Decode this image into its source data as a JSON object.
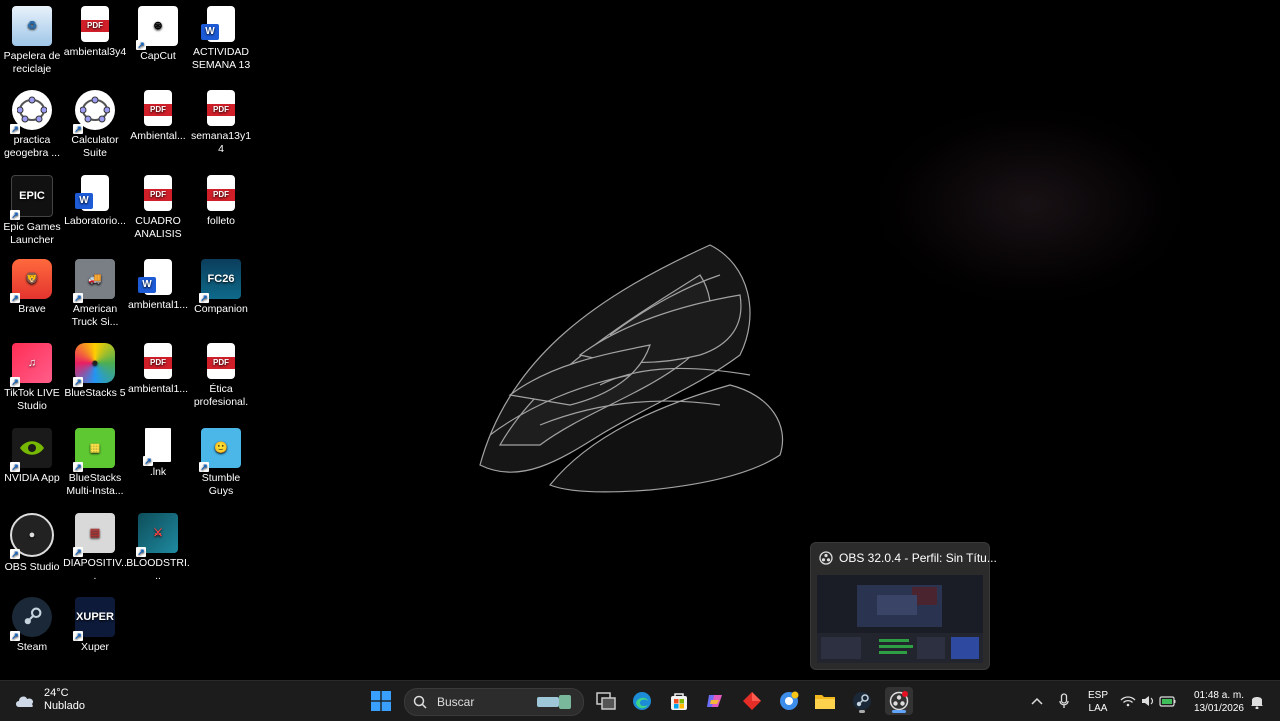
{
  "desktop_icons": [
    {
      "label": "Papelera de reciclaje",
      "icon": "recycle-bin-icon"
    },
    {
      "label": "ambiental3y4",
      "icon": "pdf-icon"
    },
    {
      "label": "CapCut",
      "icon": "capcut-icon"
    },
    {
      "label": "ACTIVIDAD SEMANA 13",
      "icon": "word-icon"
    },
    {
      "label": "practica geogebra ...",
      "icon": "geogebra-icon"
    },
    {
      "label": "Calculator Suite",
      "icon": "geogebra-icon"
    },
    {
      "label": "Ambiental...",
      "icon": "pdf-icon"
    },
    {
      "label": "semana13y14",
      "icon": "pdf-icon"
    },
    {
      "label": "Epic Games Launcher",
      "icon": "epic-games-icon"
    },
    {
      "label": "Laboratorio...",
      "icon": "word-icon"
    },
    {
      "label": "CUADRO ANALISIS",
      "icon": "pdf-icon"
    },
    {
      "label": "folleto",
      "icon": "pdf-icon"
    },
    {
      "label": "Brave",
      "icon": "brave-icon"
    },
    {
      "label": "American Truck Si...",
      "icon": "truck-icon"
    },
    {
      "label": "ambiental1...",
      "icon": "word-icon"
    },
    {
      "label": "Companion",
      "icon": "fc26-icon"
    },
    {
      "label": "TikTok LIVE Studio",
      "icon": "tiktok-icon"
    },
    {
      "label": "BlueStacks 5",
      "icon": "bluestacks-icon"
    },
    {
      "label": "ambiental1...",
      "icon": "pdf-icon"
    },
    {
      "label": "Ética profesional.",
      "icon": "pdf-icon"
    },
    {
      "label": "NVIDIA App",
      "icon": "nvidia-icon"
    },
    {
      "label": "BlueStacks Multi-Insta...",
      "icon": "bluestacks-multi-icon"
    },
    {
      "label": ".lnk",
      "icon": "blank-file-icon"
    },
    {
      "label": "Stumble Guys",
      "icon": "stumble-guys-icon"
    },
    {
      "label": "OBS Studio",
      "icon": "obs-icon"
    },
    {
      "label": "DIAPOSITIV...",
      "icon": "slides-icon"
    },
    {
      "label": "BLOODSTRI...",
      "icon": "bloodstrike-icon"
    },
    {
      "label": "Steam",
      "icon": "steam-icon"
    },
    {
      "label": "Xuper",
      "icon": "xuper-icon"
    }
  ],
  "pdf_badge": "PDF",
  "word_badge": "W",
  "popup": {
    "title": "OBS 32.0.4 - Perfil: Sin Títu..."
  },
  "taskbar": {
    "weather": {
      "temp": "24°C",
      "condition": "Nublado"
    },
    "search_placeholder": "Buscar",
    "apps": [
      "widgets-icon",
      "task-view-icon",
      "edge-icon",
      "store-icon",
      "copilot-icon",
      "red-diamond-app-icon",
      "chrome-canary-icon",
      "file-explorer-icon",
      "steam-icon",
      "obs-icon"
    ],
    "language": {
      "line1": "ESP",
      "line2": "LAA"
    },
    "clock": {
      "time": "01:48 a. m.",
      "date": "13/01/2026"
    }
  }
}
